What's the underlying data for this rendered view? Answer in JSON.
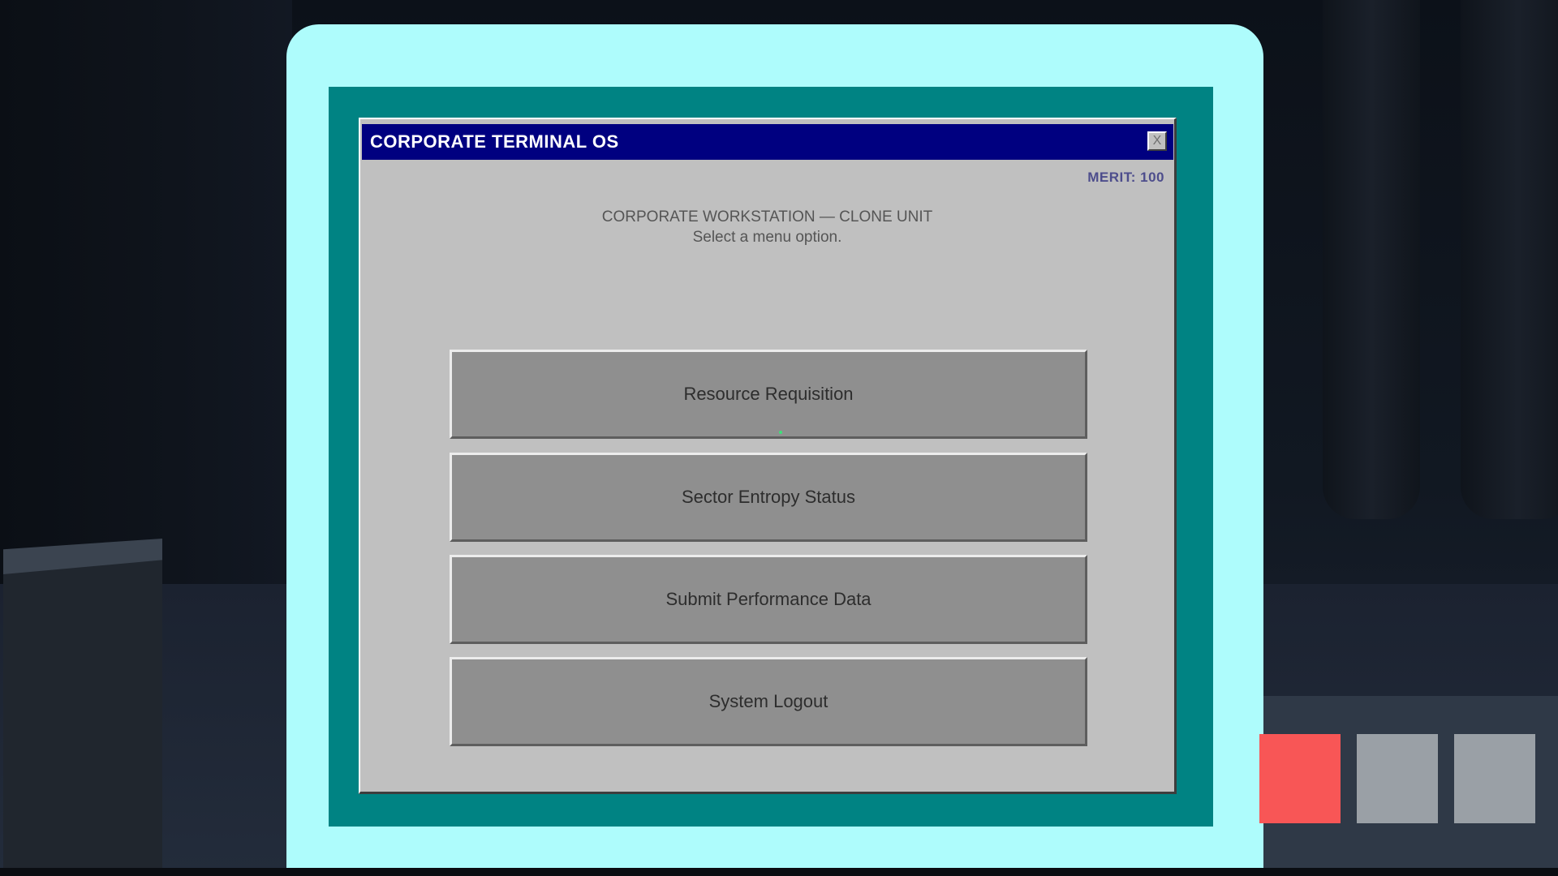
{
  "window": {
    "title": "CORPORATE TERMINAL OS",
    "close_label": "X"
  },
  "status": {
    "merit": "MERIT: 100"
  },
  "header": {
    "line1": "CORPORATE WORKSTATION — CLONE UNIT",
    "line2": "Select a menu option."
  },
  "menu": {
    "items": [
      {
        "label": "Resource Requisition"
      },
      {
        "label": "Sector Entropy Status"
      },
      {
        "label": "Submit Performance Data"
      },
      {
        "label": "System Logout"
      }
    ]
  },
  "hotbar": {
    "slots": [
      {
        "color": "#f85656",
        "selected": true
      },
      {
        "color": "#9aa0a6",
        "selected": false
      },
      {
        "color": "#9aa0a6",
        "selected": false
      }
    ]
  },
  "colors": {
    "bezel": "#aefcfc",
    "screen": "#008383",
    "titlebar": "#000080",
    "window": "#c0c0c0",
    "button": "#8f8f8f"
  }
}
